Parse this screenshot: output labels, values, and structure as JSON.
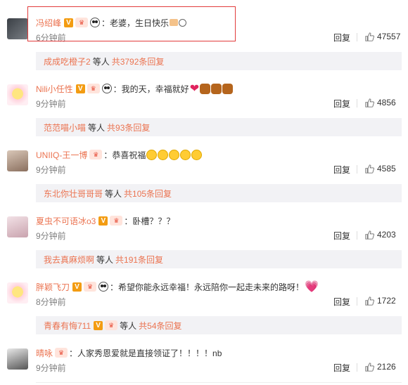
{
  "comments": [
    {
      "username": "冯绍峰",
      "text": "：老婆，生日快乐",
      "time": "6分钟前",
      "reply": "回复",
      "likes": "47557",
      "subreply": {
        "name": "成成吃橙子2",
        "mid": "等人",
        "count": "共3792条回复"
      }
    },
    {
      "username": "Nili小任性",
      "text": "：我的天，幸福就好",
      "time": "9分钟前",
      "reply": "回复",
      "likes": "4856",
      "subreply": {
        "name": "范范喵小喵",
        "mid": "等人",
        "count": "共93条回复"
      }
    },
    {
      "username": "UNIIQ-王一博",
      "text": "：恭喜祝福",
      "time": "9分钟前",
      "reply": "回复",
      "likes": "4585",
      "subreply": {
        "name": "东北你壮哥哥哥",
        "mid": "等人",
        "count": "共105条回复"
      }
    },
    {
      "username": "夏虫不可语冰o3",
      "text": "：卧槽？？？",
      "time": "9分钟前",
      "reply": "回复",
      "likes": "4203",
      "subreply": {
        "name": "我去真麻烦啊",
        "mid": "等人",
        "count": "共191条回复"
      }
    },
    {
      "username": "胖颖飞刀",
      "text": "：希望你能永远幸福！永远陪你一起走未来的路呀！",
      "time": "8分钟前",
      "reply": "回复",
      "likes": "1722",
      "subreply": {
        "name": "青春有悔711",
        "mid": "等人",
        "count": "共54条回复"
      }
    },
    {
      "username": "晴咏",
      "text": "：人家秀恩爱就是直接领证了！！！！nb",
      "time": "9分钟前",
      "reply": "回复",
      "likes": "2126"
    }
  ],
  "colors": {
    "username": "#eb7350",
    "highlight_border": "#e23c3c"
  }
}
